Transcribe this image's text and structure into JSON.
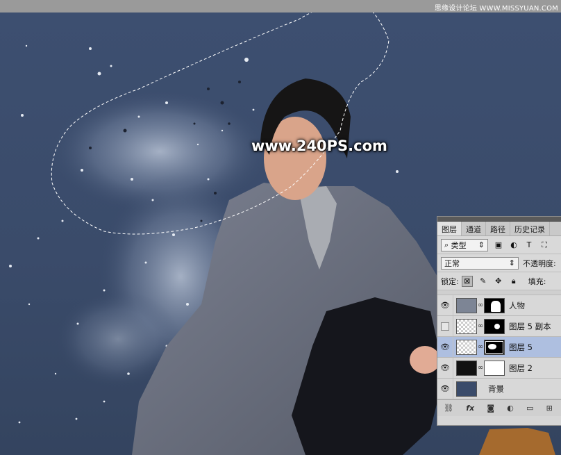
{
  "watermark_top": "思缘设计论坛 WWW.MISSYUAN.COM",
  "watermark_center": "www.240PS.com",
  "panel": {
    "tabs": [
      "图层",
      "通道",
      "路径",
      "历史记录"
    ],
    "filter_label": "类型",
    "blend_mode": "正常",
    "opacity_label": "不透明度:",
    "lock_label": "锁定:",
    "fill_label": "填充:",
    "layers": [
      {
        "name": "人物",
        "visible": true,
        "selected": false
      },
      {
        "name": "图层 5 副本",
        "visible": false,
        "selected": false
      },
      {
        "name": "图层 5",
        "visible": true,
        "selected": true
      },
      {
        "name": "图层 2",
        "visible": true,
        "selected": false
      },
      {
        "name": "背景",
        "visible": true,
        "selected": false
      }
    ],
    "bottom_icons": [
      "link-icon",
      "fx-icon",
      "mask-icon",
      "adjustment-icon",
      "group-icon",
      "new-layer-icon",
      "trash-icon"
    ]
  },
  "colors": {
    "canvas_bg": "#3a4b6a",
    "selected_layer": "#aebfe0"
  }
}
